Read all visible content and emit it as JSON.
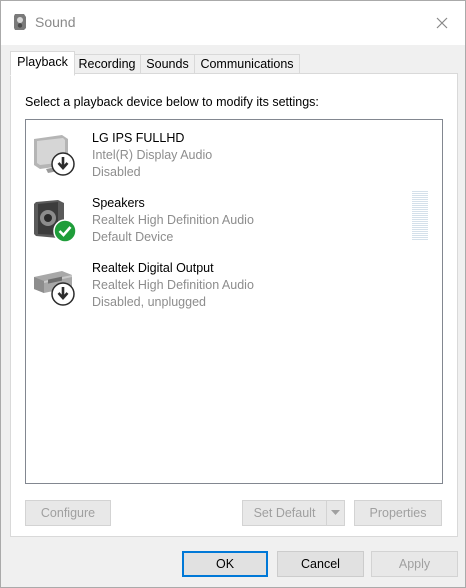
{
  "window": {
    "title": "Sound",
    "icon": "speaker-app-icon",
    "close_icon": "close-icon"
  },
  "tabs": [
    {
      "label": "Playback",
      "active": true
    },
    {
      "label": "Recording",
      "active": false
    },
    {
      "label": "Sounds",
      "active": false
    },
    {
      "label": "Communications",
      "active": false
    }
  ],
  "playback": {
    "instruction": "Select a playback device below to modify its settings:",
    "devices": [
      {
        "name": "LG IPS FULLHD",
        "driver": "Intel(R) Display Audio",
        "status": "Disabled",
        "icon": "monitor-icon",
        "badge": "down-arrow-badge-icon"
      },
      {
        "name": "Speakers",
        "driver": "Realtek High Definition Audio",
        "status": "Default Device",
        "icon": "speaker-icon",
        "badge": "green-check-badge-icon"
      },
      {
        "name": "Realtek Digital Output",
        "driver": "Realtek High Definition Audio",
        "status": "Disabled, unplugged",
        "icon": "digital-output-icon",
        "badge": "down-arrow-badge-icon"
      }
    ],
    "buttons": {
      "configure": "Configure",
      "set_default": "Set Default",
      "properties": "Properties"
    }
  },
  "dialog_buttons": {
    "ok": "OK",
    "cancel": "Cancel",
    "apply": "Apply"
  },
  "colors": {
    "check_green": "#1f9d3a",
    "badge_dark": "#2b2b2b",
    "focus_blue": "#0078d7"
  }
}
